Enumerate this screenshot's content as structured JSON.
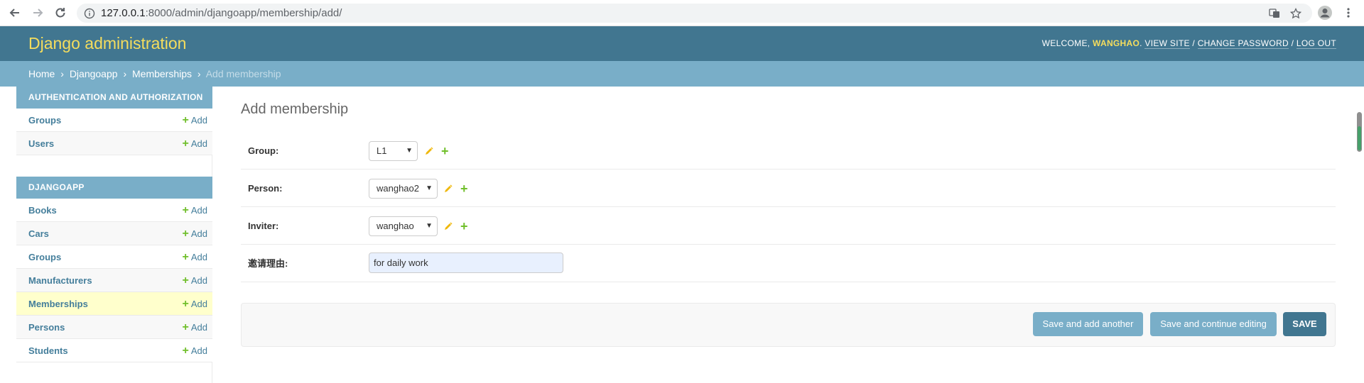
{
  "browser": {
    "url_host": "127.0.0.1",
    "url_rest": ":8000/admin/djangoapp/membership/add/"
  },
  "header": {
    "branding": "Django administration",
    "welcome": "WELCOME, ",
    "username": "WANGHAO",
    "period": ". ",
    "view_site": "VIEW SITE",
    "sep1": " / ",
    "change_password": "CHANGE PASSWORD",
    "sep2": " / ",
    "log_out": "LOG OUT"
  },
  "breadcrumbs": {
    "home": "Home",
    "app": "Djangoapp",
    "model": "Memberships",
    "current": "Add membership",
    "separator": "›"
  },
  "sidebar": {
    "add_label": "Add",
    "modules": [
      {
        "caption": "AUTHENTICATION AND AUTHORIZATION",
        "items": [
          {
            "label": "Groups"
          },
          {
            "label": "Users"
          }
        ]
      },
      {
        "caption": "DJANGOAPP",
        "items": [
          {
            "label": "Books"
          },
          {
            "label": "Cars"
          },
          {
            "label": "Groups"
          },
          {
            "label": "Manufacturers"
          },
          {
            "label": "Memberships"
          },
          {
            "label": "Persons"
          },
          {
            "label": "Students"
          }
        ]
      }
    ]
  },
  "form": {
    "title": "Add membership",
    "fields": {
      "group": {
        "label": "Group:",
        "value": "L1"
      },
      "person": {
        "label": "Person:",
        "value": "wanghao2"
      },
      "inviter": {
        "label": "Inviter:",
        "value": "wanghao"
      },
      "reason": {
        "label": "邀请理由:",
        "value": "for daily work"
      }
    }
  },
  "buttons": {
    "save_add_another": "Save and add another",
    "save_continue": "Save and continue editing",
    "save": "SAVE"
  },
  "colors": {
    "header_bg": "#417690",
    "breadcrumb_bg": "#79aec8",
    "branding": "#f5dd5d",
    "link": "#447e9b",
    "add_plus": "#70bf2b",
    "active_row": "#ffffcc"
  }
}
